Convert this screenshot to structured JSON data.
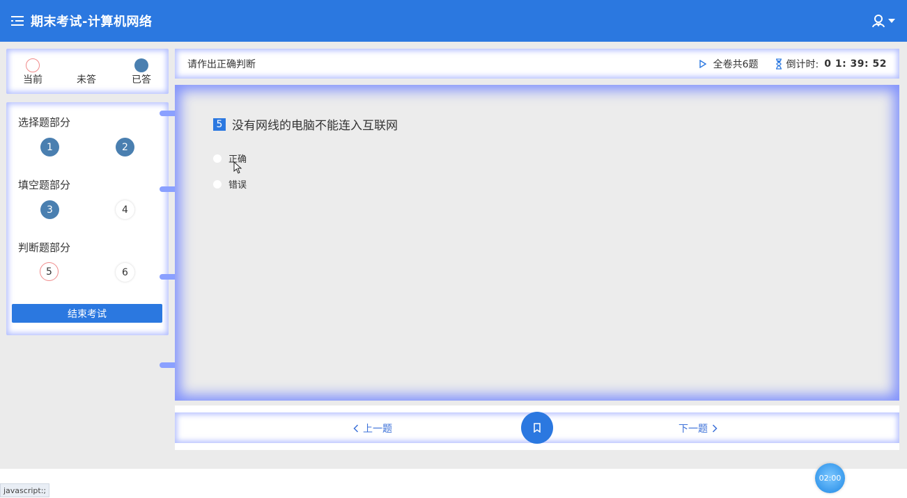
{
  "header": {
    "title": "期末考试-计算机网络"
  },
  "legend": [
    {
      "label": "当前",
      "style": "current"
    },
    {
      "label": "未答",
      "style": "blank"
    },
    {
      "label": "已答",
      "style": "answered"
    }
  ],
  "sections": [
    {
      "title": "选择题部分",
      "questions": [
        {
          "num": "1",
          "state": "answered"
        },
        {
          "num": "2",
          "state": "answered"
        }
      ]
    },
    {
      "title": "填空题部分",
      "questions": [
        {
          "num": "3",
          "state": "answered"
        },
        {
          "num": "4",
          "state": "blank"
        }
      ]
    },
    {
      "title": "判断题部分",
      "questions": [
        {
          "num": "5",
          "state": "current"
        },
        {
          "num": "6",
          "state": "blank"
        }
      ]
    }
  ],
  "finish_label": "结束考试",
  "question_header": {
    "instruction": "请作出正确判断",
    "total": "全卷共6题",
    "countdown_label": "倒计时:",
    "countdown_value": "0 1: 39: 52"
  },
  "question": {
    "index": "5",
    "text": "没有网线的电脑不能连入互联网",
    "options": [
      {
        "label": "正确"
      },
      {
        "label": "错误"
      }
    ]
  },
  "nav": {
    "prev": "上一题",
    "next": "下一题"
  },
  "clock_badge": "02:00",
  "status_text": "javascript:;",
  "colors": {
    "primary": "#2b78e0",
    "answered": "#4a7fb0",
    "current_border": "#f08a8a",
    "glow": "#8aa0ff"
  }
}
